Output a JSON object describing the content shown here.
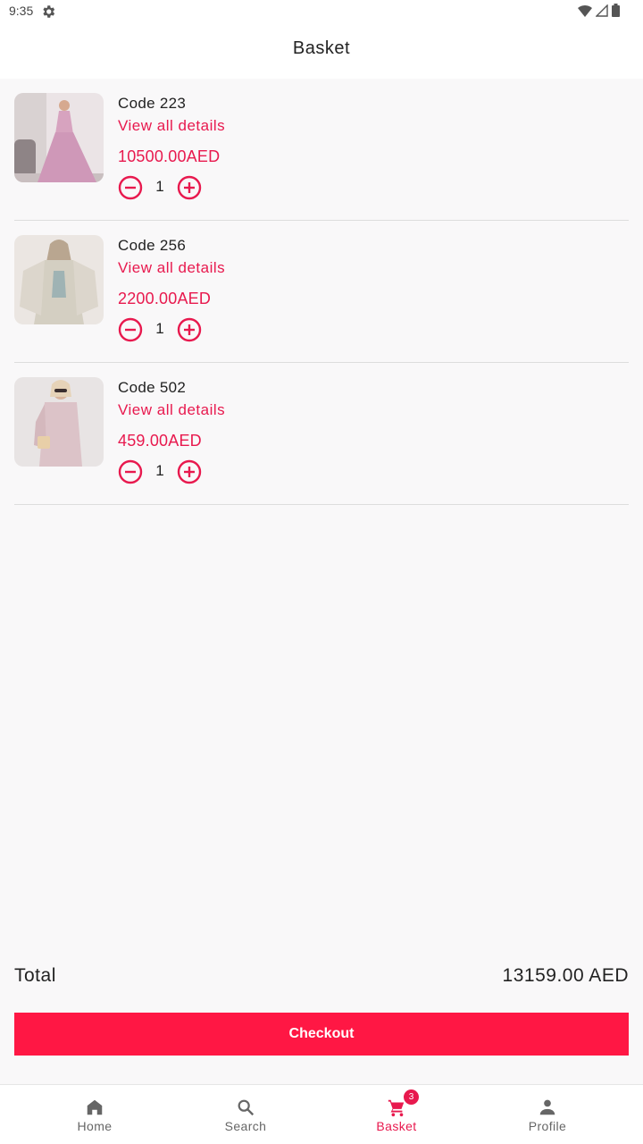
{
  "status_bar": {
    "time": "9:35"
  },
  "header": {
    "title": "Basket"
  },
  "items": [
    {
      "code": "Code 223",
      "link": "View all details",
      "price": "10500.00AED",
      "quantity": "1"
    },
    {
      "code": "Code 256",
      "link": "View all details",
      "price": "2200.00AED",
      "quantity": "1"
    },
    {
      "code": "Code 502",
      "link": "View all details",
      "price": "459.00AED",
      "quantity": "1"
    }
  ],
  "summary": {
    "total_label": "Total",
    "total_value": "13159.00 AED"
  },
  "checkout_label": "Checkout",
  "nav": {
    "items": [
      {
        "label": "Home",
        "icon": "home-icon"
      },
      {
        "label": "Search",
        "icon": "search-icon"
      },
      {
        "label": "Basket",
        "icon": "cart-icon",
        "badge": "3",
        "active": true
      },
      {
        "label": "Profile",
        "icon": "person-icon"
      }
    ]
  },
  "colors": {
    "accent": "#e8194e",
    "button": "#ff1744",
    "background": "#f9f8f9"
  }
}
